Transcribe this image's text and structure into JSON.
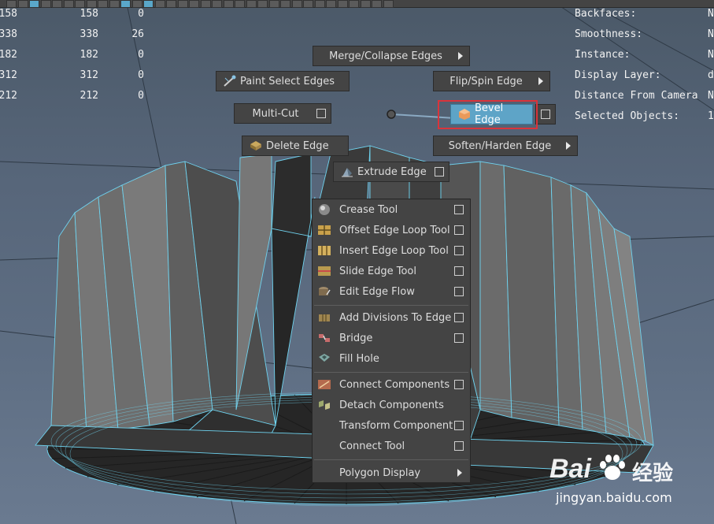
{
  "hud_left": {
    "rows": [
      [
        "158",
        "158",
        "0"
      ],
      [
        "338",
        "338",
        "26"
      ],
      [
        "182",
        "182",
        "0"
      ],
      [
        "312",
        "312",
        "0"
      ],
      [
        "212",
        "212",
        "0"
      ]
    ]
  },
  "hud_right": {
    "rows": [
      {
        "label": "Backfaces:",
        "value": "N"
      },
      {
        "label": "Smoothness:",
        "value": "N"
      },
      {
        "label": "Instance:",
        "value": "N"
      },
      {
        "label": "Display Layer:",
        "value": "d"
      },
      {
        "label": "Distance From Camera",
        "value": "N"
      },
      {
        "label": "Selected Objects:",
        "value": "1"
      }
    ]
  },
  "marking_menu": {
    "north": "Merge/Collapse Edges",
    "northwest": "Paint Select Edges",
    "northeast": "Flip/Spin Edge",
    "west": "Multi-Cut",
    "east": "Bevel Edge",
    "southwest": "Delete Edge",
    "southeast": "Soften/Harden Edge",
    "south": "Extrude Edge"
  },
  "overflow_menu": {
    "groups": [
      [
        {
          "label": "Crease Tool",
          "icon": "crease-tool-icon",
          "option": true
        },
        {
          "label": "Offset Edge Loop Tool",
          "icon": "offset-edge-loop-icon",
          "option": true
        },
        {
          "label": "Insert Edge Loop Tool",
          "icon": "insert-edge-loop-icon",
          "option": true
        },
        {
          "label": "Slide Edge Tool",
          "icon": "slide-edge-icon",
          "option": true
        },
        {
          "label": "Edit Edge Flow",
          "icon": "edit-edge-flow-icon",
          "option": true
        }
      ],
      [
        {
          "label": "Add Divisions To Edge",
          "icon": "add-divisions-icon",
          "option": true
        },
        {
          "label": "Bridge",
          "icon": "bridge-icon",
          "option": true
        },
        {
          "label": "Fill Hole",
          "icon": "fill-hole-icon",
          "option": false
        }
      ],
      [
        {
          "label": "Connect Components",
          "icon": "connect-components-icon",
          "option": true
        },
        {
          "label": "Detach Components",
          "icon": "detach-components-icon",
          "option": false
        },
        {
          "label": "Transform Component",
          "icon": "",
          "option": true
        },
        {
          "label": "Connect Tool",
          "icon": "",
          "option": true
        }
      ]
    ],
    "submenu": "Polygon Display"
  },
  "watermark": {
    "brand_left": "Bai",
    "brand_right": "经验",
    "url": "jingyan.baidu.com"
  },
  "colors": {
    "highlight": "#5ea4c7",
    "selection_box": "#d9343b",
    "wireframe": "#6fd3ef",
    "menu_bg": "#444444"
  }
}
